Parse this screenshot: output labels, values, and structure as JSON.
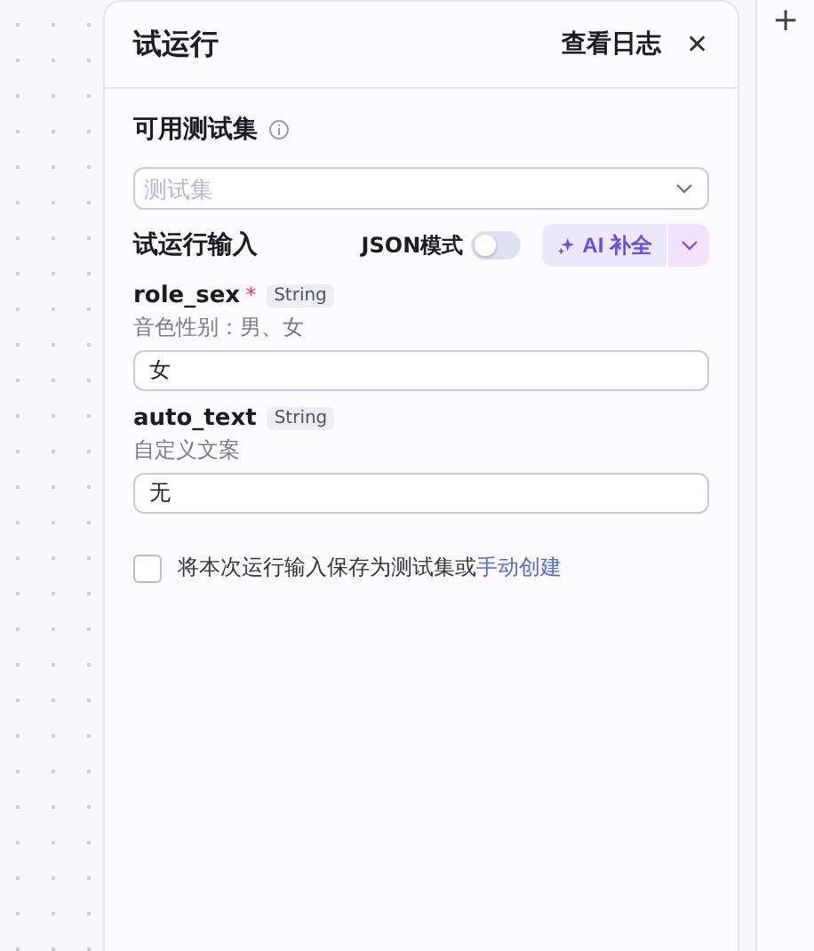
{
  "panel": {
    "title": "试运行",
    "log_link": "查看日志",
    "close": "✕"
  },
  "test_set": {
    "label": "可用测试集",
    "placeholder": "测试集"
  },
  "run_input": {
    "label": "试运行输入",
    "json_mode": {
      "label": "JSON模式",
      "on": false
    },
    "ai_button": "AI 补全"
  },
  "params": [
    {
      "name": "role_sex",
      "required_mark": "*",
      "type": "String",
      "description": "音色性别：男、女",
      "value": "女"
    },
    {
      "name": "auto_text",
      "type": "String",
      "description": "自定义文案",
      "value": "无"
    }
  ],
  "save": {
    "checked": false,
    "text": "将本次运行输入保存为测试集或",
    "link": "手动创建"
  },
  "canvas": {
    "add": "+"
  }
}
